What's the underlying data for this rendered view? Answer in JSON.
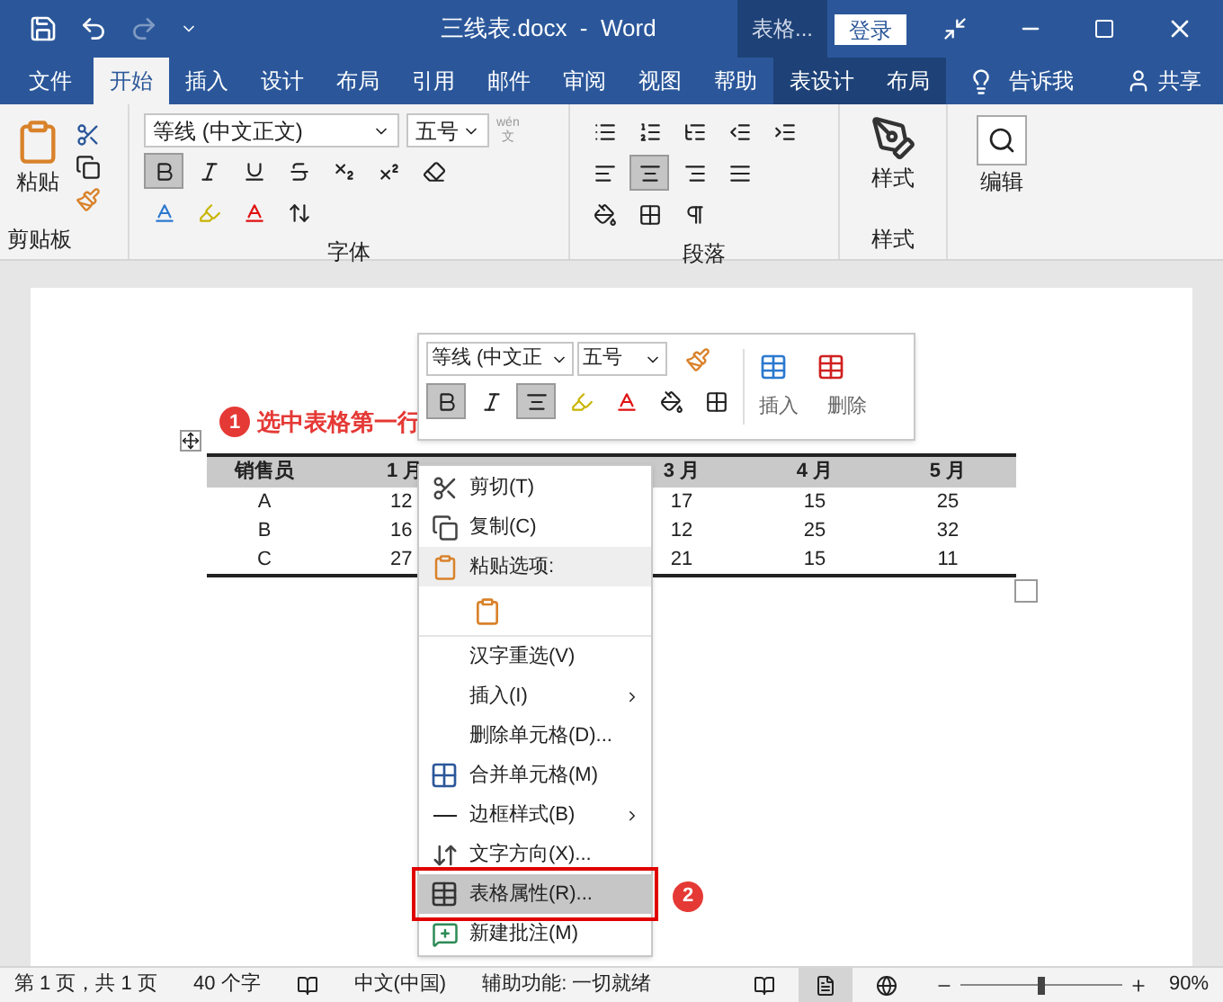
{
  "window": {
    "title": "三线表.docx  -  Word",
    "context_label": "表格...",
    "login": "登录"
  },
  "tabs": [
    {
      "label": "文件",
      "selected": false,
      "kind": "file"
    },
    {
      "label": "开始",
      "selected": true,
      "kind": "normal"
    },
    {
      "label": "插入",
      "selected": false,
      "kind": "normal"
    },
    {
      "label": "设计",
      "selected": false,
      "kind": "normal"
    },
    {
      "label": "布局",
      "selected": false,
      "kind": "normal"
    },
    {
      "label": "引用",
      "selected": false,
      "kind": "normal"
    },
    {
      "label": "邮件",
      "selected": false,
      "kind": "normal"
    },
    {
      "label": "审阅",
      "selected": false,
      "kind": "normal"
    },
    {
      "label": "视图",
      "selected": false,
      "kind": "normal"
    },
    {
      "label": "帮助",
      "selected": false,
      "kind": "normal"
    },
    {
      "label": "表设计",
      "selected": false,
      "kind": "context"
    },
    {
      "label": "布局",
      "selected": false,
      "kind": "context"
    }
  ],
  "tell_me": "告诉我",
  "share": "共享",
  "ribbon": {
    "paste": "粘贴",
    "font_name": "等线 (中文正文)",
    "font_size": "五号",
    "phonetic_top": "wén",
    "phonetic_bottom": "文",
    "bold_pressed": true,
    "center_pressed": true,
    "styles": "样式",
    "editing": "编辑",
    "groups": [
      "剪贴板",
      "字体",
      "段落",
      "样式"
    ]
  },
  "mini_toolbar": {
    "font_name": "等线 (中文正",
    "font_size": "五号",
    "bold_pressed": true,
    "center_pressed": true,
    "insert": "插入",
    "delete": "删除"
  },
  "steps": [
    {
      "number": "1",
      "text": "选中表格第一行"
    },
    {
      "number": "2"
    }
  ],
  "table": {
    "columns": [
      "销售员",
      "1 月",
      "3 月",
      "4 月",
      "5 月"
    ],
    "rows": [
      [
        "A",
        "12",
        "17",
        "15",
        "25"
      ],
      [
        "B",
        "16",
        "12",
        "25",
        "32"
      ],
      [
        "C",
        "27",
        "21",
        "15",
        "11"
      ]
    ]
  },
  "context_menu": [
    {
      "kind": "item",
      "label": "剪切(T)",
      "selected": false
    },
    {
      "kind": "item",
      "label": "复制(C)",
      "selected": false
    },
    {
      "kind": "header",
      "label": "粘贴选项:",
      "selected": false
    },
    {
      "kind": "paste-option",
      "selected": false
    },
    {
      "kind": "item",
      "label": "汉字重选(V)",
      "selected": false
    },
    {
      "kind": "submenu",
      "label": "插入(I)",
      "selected": false
    },
    {
      "kind": "item",
      "label": "删除单元格(D)...",
      "selected": false
    },
    {
      "kind": "item",
      "label": "合并单元格(M)",
      "selected": false
    },
    {
      "kind": "submenu",
      "label": "边框样式(B)",
      "selected": false
    },
    {
      "kind": "item",
      "label": "文字方向(X)...",
      "selected": false
    },
    {
      "kind": "item",
      "label": "表格属性(R)...",
      "selected": true
    },
    {
      "kind": "item",
      "label": "新建批注(M)",
      "selected": false
    }
  ],
  "status_bar": {
    "page": "第 1 页，共 1 页",
    "words": "40 个字",
    "language": "中文(中国)",
    "accessibility": "辅助功能: 一切就绪",
    "views": [
      {
        "kind": "read",
        "selected": false
      },
      {
        "kind": "print",
        "selected": true
      },
      {
        "kind": "web",
        "selected": false
      }
    ],
    "zoom": {
      "level": 0.5,
      "reading": "90%"
    }
  }
}
